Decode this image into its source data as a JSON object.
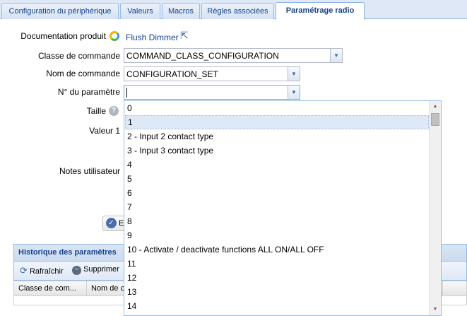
{
  "tabs": [
    {
      "label": "Configuration du périphérique"
    },
    {
      "label": "Valeurs"
    },
    {
      "label": "Macros"
    },
    {
      "label": "Règles associées"
    },
    {
      "label": "Paramétrage radio"
    }
  ],
  "form": {
    "doc_label": "Documentation produit",
    "doc_link": "Flush Dimmer",
    "class_label": "Classe de commande",
    "class_value": "COMMAND_CLASS_CONFIGURATION",
    "command_label": "Nom de commande",
    "command_value": "CONFIGURATION_SET",
    "param_label": "N° du paramètre",
    "param_value": "",
    "size_label": "Taille",
    "value1_label": "Valeur 1",
    "notes_label": "Notes utilisateur",
    "button_partial": "E"
  },
  "param_options": [
    "0",
    "1",
    "2 - Input 2 contact type",
    "3 - Input 3 contact type",
    "4",
    "5",
    "6",
    "7",
    "8",
    "9",
    "10 - Activate / deactivate functions ALL ON/ALL OFF",
    "11",
    "12",
    "13",
    "14"
  ],
  "selected_option": 1,
  "history": {
    "title": "Historique des paramètres",
    "refresh_label": "Rafraîchir",
    "delete_label": "Supprimer",
    "columns": [
      "Classe de com...",
      "Nom de c"
    ]
  }
}
